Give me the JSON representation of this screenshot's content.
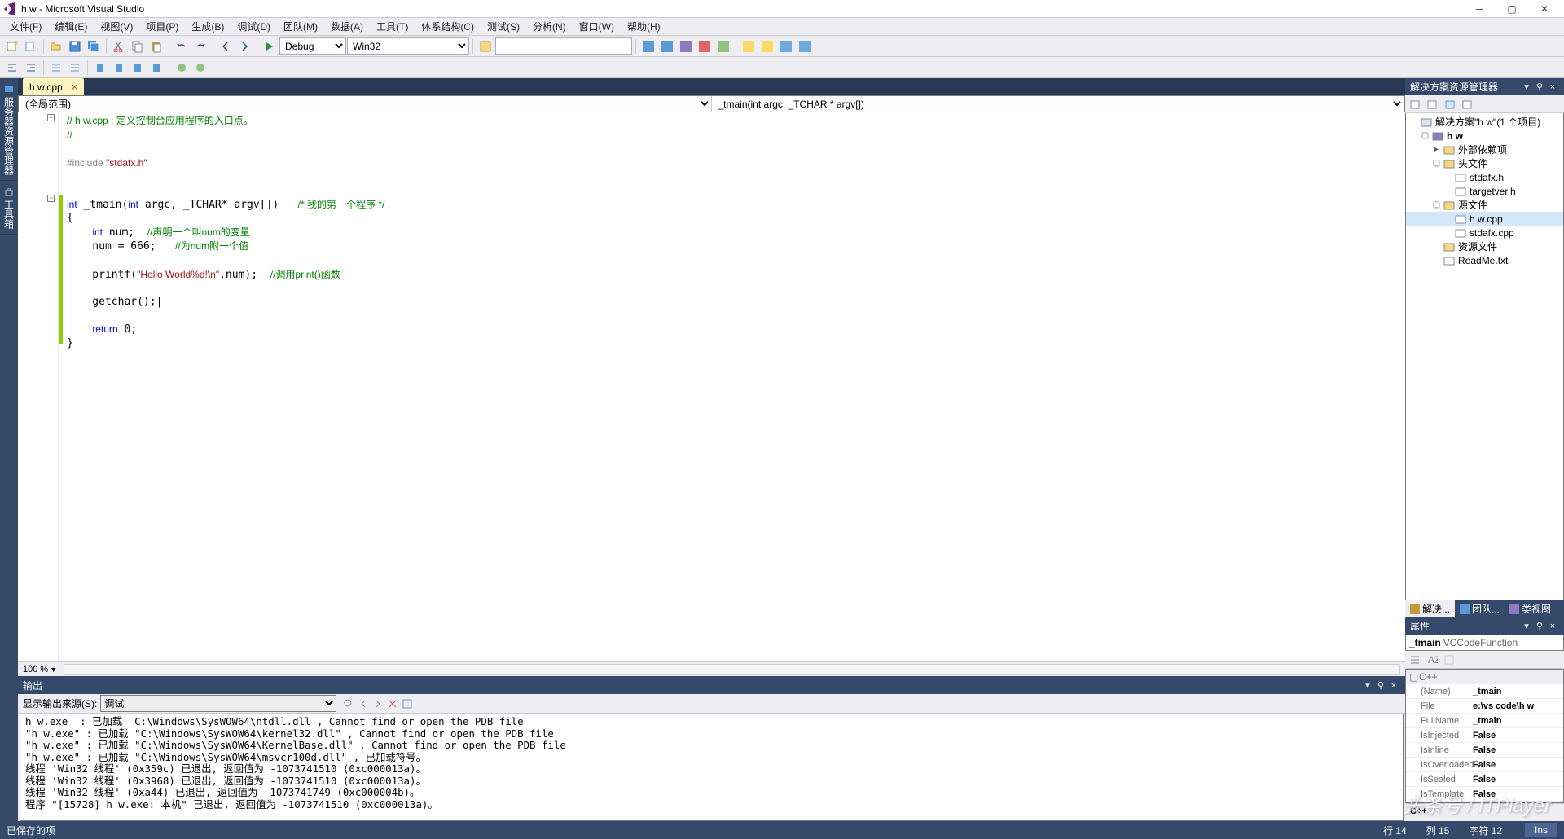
{
  "title": "h w - Microsoft Visual Studio",
  "menus": [
    "文件(F)",
    "编辑(E)",
    "视图(V)",
    "项目(P)",
    "生成(B)",
    "调试(D)",
    "团队(M)",
    "数据(A)",
    "工具(T)",
    "体系结构(C)",
    "测试(S)",
    "分析(N)",
    "窗口(W)",
    "帮助(H)"
  ],
  "toolbar": {
    "config": "Debug",
    "platform": "Win32",
    "search": ""
  },
  "doc_tab": {
    "label": "h w.cpp",
    "close": "×"
  },
  "nav": {
    "scope": "(全局范围)",
    "member": "_tmain(int argc, _TCHAR * argv[])"
  },
  "zoom": "100 %",
  "code_lines": [
    {
      "t": "com",
      "text": "// h w.cpp : 定义控制台应用程序的入口点。"
    },
    {
      "t": "com",
      "text": "//"
    },
    {
      "t": "",
      "text": ""
    },
    {
      "t": "inc",
      "text": "#include \"stdafx.h\""
    },
    {
      "t": "",
      "text": ""
    },
    {
      "t": "",
      "text": ""
    },
    {
      "t": "fn",
      "text": "int _tmain(int argc, _TCHAR* argv[])   /* 我的第一个程序 */"
    },
    {
      "t": "",
      "text": "{"
    },
    {
      "t": "var",
      "text": "    int num;  //声明一个叫num的变量"
    },
    {
      "t": "asn",
      "text": "    num = 666;   //为num附一个值"
    },
    {
      "t": "",
      "text": ""
    },
    {
      "t": "prt",
      "text": "    printf(\"Hello World%d!\\n\",num);  //调用print()函数"
    },
    {
      "t": "",
      "text": ""
    },
    {
      "t": "gc",
      "text": "    getchar();|"
    },
    {
      "t": "",
      "text": ""
    },
    {
      "t": "ret",
      "text": "    return 0;"
    },
    {
      "t": "",
      "text": "}"
    }
  ],
  "solution_explorer": {
    "title": "解决方案资源管理器",
    "root": "解决方案\"h w\"(1 个项目)",
    "project": "h w",
    "ext_deps": "外部依赖项",
    "headers": "头文件",
    "header_files": [
      "stdafx.h",
      "targetver.h"
    ],
    "sources": "源文件",
    "source_files": [
      "h w.cpp",
      "stdafx.cpp"
    ],
    "resources": "资源文件",
    "readme": "ReadMe.txt"
  },
  "sol_tabs": [
    "解决...",
    "团队...",
    "类视图"
  ],
  "props": {
    "title": "属性",
    "obj": "_tmain VCCodeFunction",
    "cat": "C++",
    "rows": [
      {
        "n": "(Name)",
        "v": "_tmain"
      },
      {
        "n": "File",
        "v": "e:\\vs code\\h w"
      },
      {
        "n": "FullName",
        "v": "_tmain"
      },
      {
        "n": "IsInjected",
        "v": "False"
      },
      {
        "n": "IsInline",
        "v": "False"
      },
      {
        "n": "IsOverloaded",
        "v": "False"
      },
      {
        "n": "IsSealed",
        "v": "False"
      },
      {
        "n": "IsTemplate",
        "v": "False"
      }
    ],
    "footer": "C++"
  },
  "output": {
    "title": "输出",
    "source_label": "显示输出来源(S):",
    "source": "调试",
    "lines": [
      "h w.exe  : 已加载  C:\\Windows\\SysWOW64\\ntdll.dll , Cannot find or open the PDB file",
      "\"h w.exe\" : 已加载 \"C:\\Windows\\SysWOW64\\kernel32.dll\" , Cannot find or open the PDB file",
      "\"h w.exe\" : 已加载 \"C:\\Windows\\SysWOW64\\KernelBase.dll\" , Cannot find or open the PDB file",
      "\"h w.exe\" : 已加载 \"C:\\Windows\\SysWOW64\\msvcr100d.dll\" , 已加载符号。",
      "线程 'Win32 线程' (0x359c) 已退出, 返回值为 -1073741510 (0xc000013a)。",
      "线程 'Win32 线程' (0x3968) 已退出, 返回值为 -1073741510 (0xc000013a)。",
      "线程 'Win32 线程' (0xa44) 已退出, 返回值为 -1073741749 (0xc000004b)。",
      "程序 \"[15728] h w.exe: 本机\" 已退出, 返回值为 -1073741510 (0xc000013a)。"
    ]
  },
  "left_tabs": [
    "服务器资源管理器",
    "工具箱"
  ],
  "status": {
    "saved": "已保存的项",
    "line": "行 14",
    "col": "列 15",
    "ch": "字符 12",
    "ins": "Ins"
  },
  "watermark": "头条号 / ITPlayer"
}
